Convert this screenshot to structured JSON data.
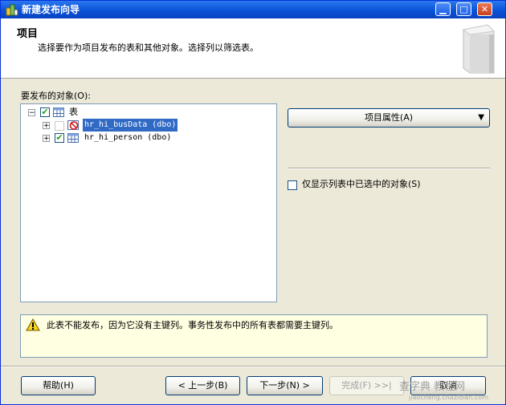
{
  "window": {
    "title": "新建发布向导"
  },
  "header": {
    "title": "项目",
    "description": "选择要作为项目发布的表和其他对象。选择列以筛选表。"
  },
  "objects": {
    "label": "要发布的对象(O):",
    "tree": {
      "root": {
        "label": "表",
        "checked": true
      },
      "items": [
        {
          "label": "hr_hi_busData (dbo)",
          "checked": false,
          "blocked": true,
          "selected": true
        },
        {
          "label": "hr_hi_person (dbo)",
          "checked": true,
          "blocked": false,
          "selected": false
        }
      ]
    }
  },
  "article_props": {
    "label": "项目属性(A)"
  },
  "show_selected": {
    "label": "仅显示列表中已选中的对象(S)",
    "checked": false
  },
  "message": {
    "text": "此表不能发布，因为它没有主键列。事务性发布中的所有表都需要主键列。"
  },
  "buttons": {
    "help": "帮助(H)",
    "back": "< 上一步(B)",
    "next": "下一步(N) >",
    "finish": "完成(F) >>|",
    "cancel": "取消"
  },
  "watermark": {
    "line1": "查字典 教程网",
    "line2": "jiaocheng.chazidian.com"
  },
  "colors": {
    "titlebar": "#0a53d8",
    "message_bg": "#ffffe1",
    "selection": "#316ac5"
  }
}
